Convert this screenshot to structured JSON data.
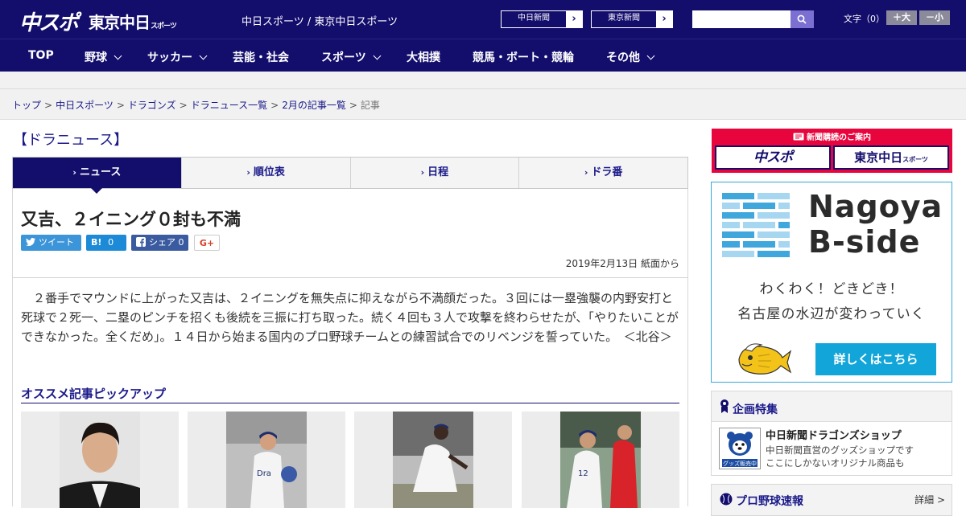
{
  "header": {
    "logo_chuspo": "中スポ",
    "logo_tokyo": "東京中日",
    "logo_tokyo_small": "スポーツ",
    "site_name": "中日スポーツ / 東京中日スポーツ",
    "paper_links": [
      "中日新聞",
      "東京新聞"
    ],
    "search_placeholder": "",
    "font_size_label": "文字（0）",
    "font_larger": "＋大",
    "font_smaller": "－小"
  },
  "nav": [
    {
      "label": "TOP",
      "has_menu": false
    },
    {
      "label": "野球",
      "has_menu": true
    },
    {
      "label": "サッカー",
      "has_menu": true
    },
    {
      "label": "芸能・社会",
      "has_menu": false
    },
    {
      "label": "スポーツ",
      "has_menu": true
    },
    {
      "label": "大相撲",
      "has_menu": false
    },
    {
      "label": "競馬・ボート・競輪",
      "has_menu": false
    },
    {
      "label": "その他",
      "has_menu": true
    }
  ],
  "breadcrumb": {
    "items": [
      "トップ",
      "中日スポーツ",
      "ドラゴンズ",
      "ドラニュース一覧",
      "2月の記事一覧"
    ],
    "separator": ">",
    "current": "記事"
  },
  "section_title": "【ドラニュース】",
  "tabs": [
    "ニュース",
    "順位表",
    "日程",
    "ドラ番"
  ],
  "active_tab": 0,
  "article": {
    "headline": "又吉、２イニング０封も不満",
    "share": {
      "tweet": "ツイート",
      "hatena": "B!",
      "hatena_count": "0",
      "facebook": "シェア",
      "facebook_count": "0",
      "gplus": "G+"
    },
    "date": "2019年2月13日 紙面から",
    "body": "２番手でマウンドに上がった又吉は、２イニングを無失点に抑えながら不満顔だった。３回には一塁強襲の内野安打と死球で２死一、二塁のピンチを招くも後続を三振に打ち取った。続く４回も３人で攻撃を終わらせたが、「やりたいことができなかった。全くだめ」。１４日から始まる国内のプロ野球チームとの練習試合でのリベンジを誓っていた。　＜北谷＞",
    "pickup_title": "オススメ記事ピックアップ"
  },
  "sidebar": {
    "subscribe_title": "新聞購読のご案内",
    "subscribe_chuspo": "中スポ",
    "subscribe_tokyo": "東京中日",
    "subscribe_tokyo_small": "スポーツ",
    "ad": {
      "city_line1": "Nagoya",
      "city_line2": "B-side",
      "copy_line1": "わくわく！どきどき！",
      "copy_line2": "名古屋の水辺が変わっていく",
      "cta": "詳しくはこちら"
    },
    "feature": {
      "heading": "企画特集",
      "name": "中日新聞ドラゴンズショップ",
      "desc_line1": "中日新聞直営のグッズショップです",
      "desc_line2": "ここにしかないオリジナル商品も",
      "badge": "グッズ販売中"
    },
    "score": {
      "heading": "プロ野球速報",
      "more": "詳細 >"
    }
  },
  "colors": {
    "navy": "#130d6c",
    "link": "#1b1a8a",
    "red": "#e8043c",
    "cyan": "#12a5d9"
  }
}
